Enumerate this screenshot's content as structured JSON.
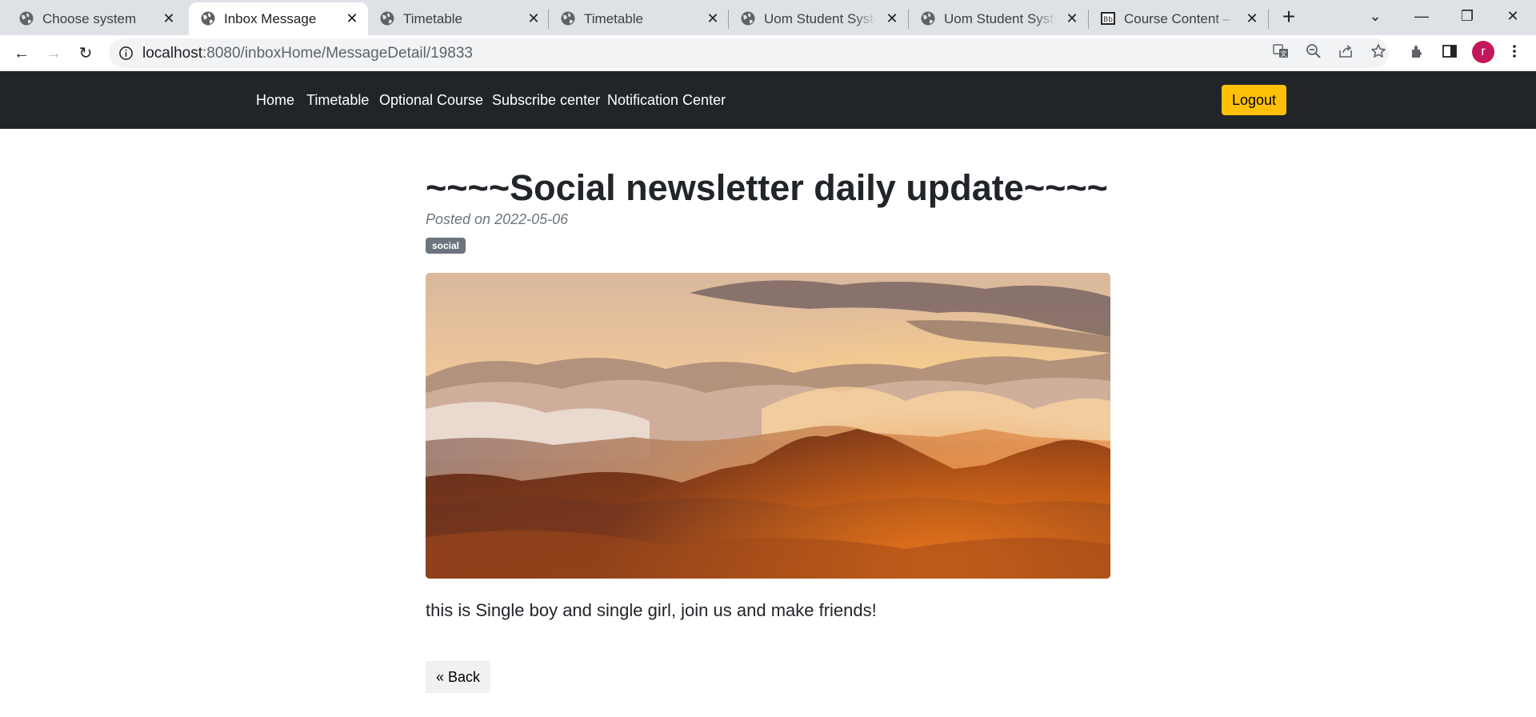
{
  "browser": {
    "tabs": [
      {
        "title": "Choose system",
        "active": false
      },
      {
        "title": "Inbox Message",
        "active": true
      },
      {
        "title": "Timetable",
        "active": false
      },
      {
        "title": "Timetable",
        "active": false
      },
      {
        "title": "Uom Student System",
        "active": false
      },
      {
        "title": "Uom Student System",
        "active": false
      },
      {
        "title": "Course Content – Course",
        "active": false
      }
    ],
    "url_host": "localhost",
    "url_path": ":8080/inboxHome/MessageDetail/19833",
    "profile_initial": "r"
  },
  "nav": {
    "links": [
      "Home",
      "Timetable",
      "Optional Course",
      "Subscribe center",
      "Notification Center"
    ],
    "logout_label": "Logout"
  },
  "post": {
    "title": "~~~~Social newsletter daily update~~~~",
    "date": "Posted on 2022-05-06",
    "tag": "social",
    "body": "this is Single boy and single girl, join us and make friends!",
    "back_label": "« Back"
  },
  "colors": {
    "navbar_bg": "#212529",
    "logout_bg": "#ffc107",
    "badge_bg": "#6c757d"
  }
}
